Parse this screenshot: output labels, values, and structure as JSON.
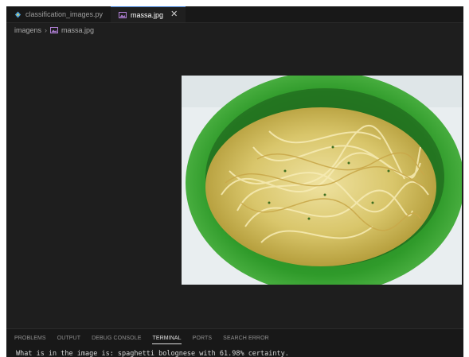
{
  "tabs": [
    {
      "label": "classification_images.py",
      "icon": "python-file-icon",
      "active": false
    },
    {
      "label": "massa.jpg",
      "icon": "image-file-icon",
      "active": true
    }
  ],
  "breadcrumb": {
    "folder": "imagens",
    "file": "massa.jpg"
  },
  "viewer": {
    "image": "green bowl of spaghetti pasta"
  },
  "panel": {
    "tabs": [
      "PROBLEMS",
      "OUTPUT",
      "DEBUG CONSOLE",
      "TERMINAL",
      "PORTS",
      "SEARCH ERROR"
    ],
    "active_tab": "TERMINAL",
    "terminal_output": "What is in the image is: spaghetti bolognese with 61.98% certainty."
  },
  "colors": {
    "editor_bg": "#1e1e1e",
    "tab_accent": "#3a7bd5",
    "bowl_green": "#2f8f2b"
  }
}
